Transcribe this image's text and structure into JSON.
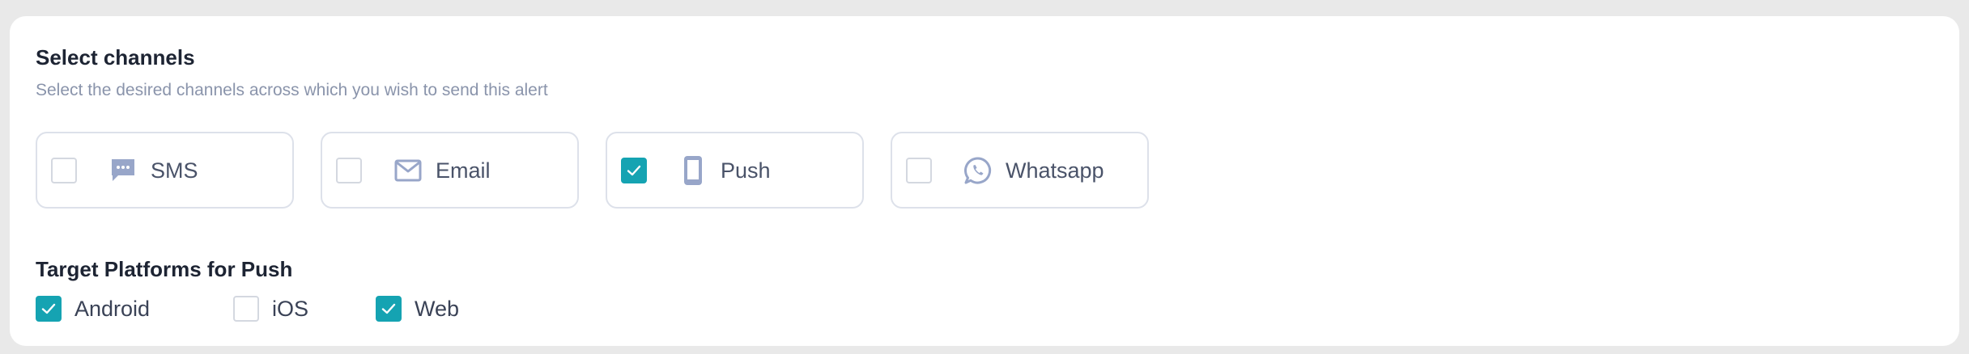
{
  "section": {
    "title": "Select channels",
    "subtitle": "Select the desired channels across which you wish to send this alert"
  },
  "channels": [
    {
      "label": "SMS",
      "icon": "sms-bubble-icon",
      "checked": false
    },
    {
      "label": "Email",
      "icon": "envelope-icon",
      "checked": false
    },
    {
      "label": "Push",
      "icon": "mobile-phone-icon",
      "checked": true
    },
    {
      "label": "Whatsapp",
      "icon": "whatsapp-icon",
      "checked": false
    }
  ],
  "platforms": {
    "title": "Target Platforms for Push",
    "items": [
      {
        "label": "Android",
        "checked": true
      },
      {
        "label": "iOS",
        "checked": false
      },
      {
        "label": "Web",
        "checked": true
      }
    ]
  },
  "colors": {
    "accent": "#15a3b2",
    "icon": "#98a6c9",
    "border": "#dde1ea",
    "title": "#1d2433",
    "subtitle": "#8a94ab"
  }
}
